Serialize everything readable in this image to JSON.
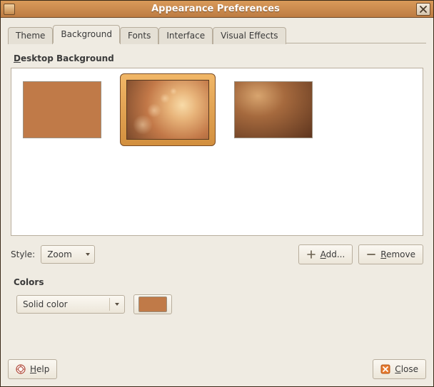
{
  "window": {
    "title": "Appearance Preferences"
  },
  "tabs": {
    "theme": "Theme",
    "background": "Background",
    "fonts": "Fonts",
    "interface": "Interface",
    "visual_effects": "Visual Effects"
  },
  "section": {
    "desktop_bg_prefix": "D",
    "desktop_bg_rest": "esktop Background",
    "colors": "Colors"
  },
  "style": {
    "label": "Style:",
    "value": "Zoom"
  },
  "buttons": {
    "add_prefix": "A",
    "add_rest": "dd...",
    "remove_prefix": "R",
    "remove_rest": "emove",
    "help_prefix": "H",
    "help_rest": "elp",
    "close_prefix": "C",
    "close_rest": "lose"
  },
  "colors": {
    "mode": "Solid color",
    "swatch": "#c07a48"
  }
}
